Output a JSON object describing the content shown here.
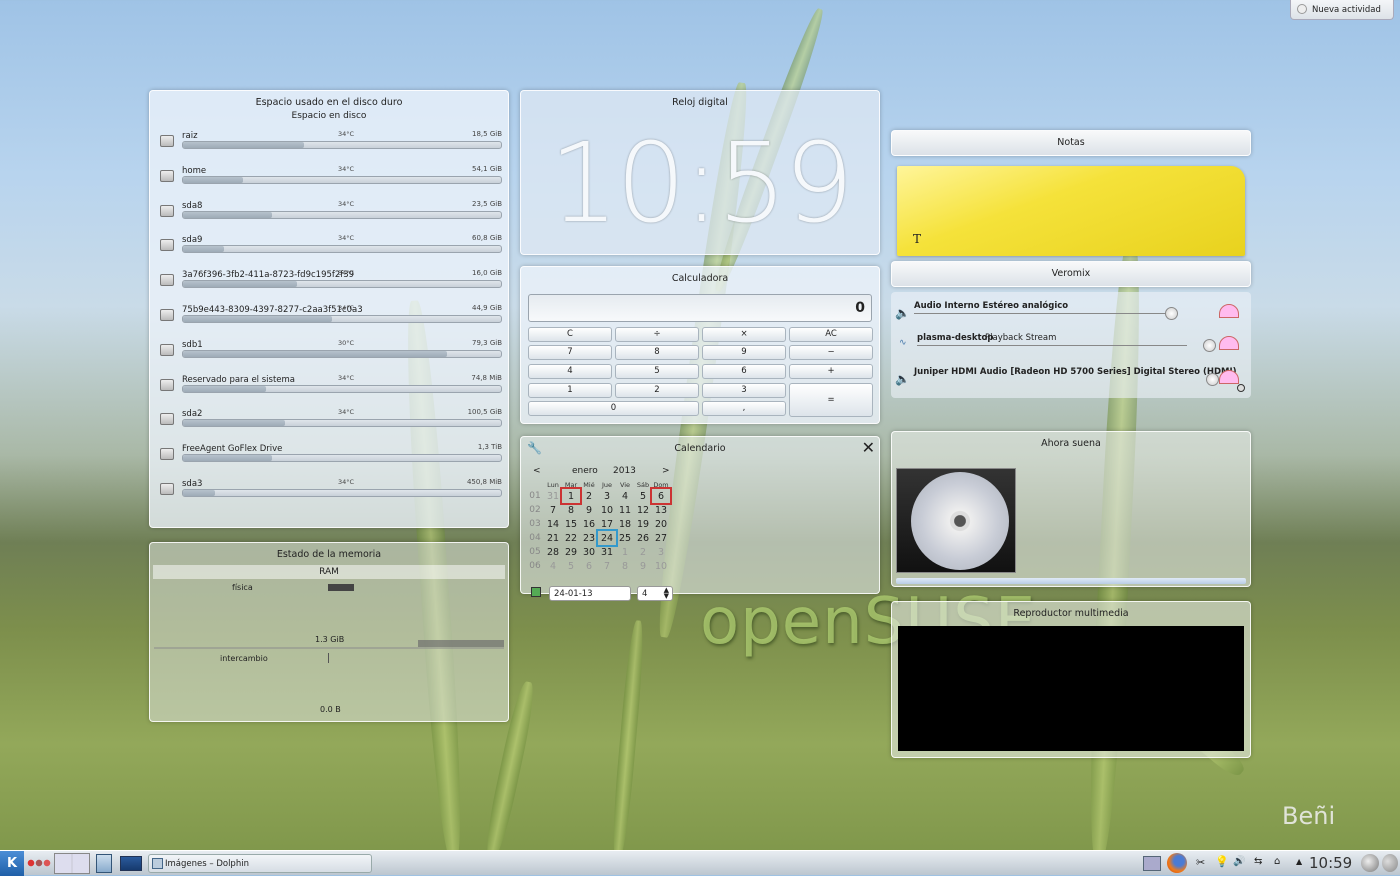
{
  "top_button": {
    "label": "Nueva actividad"
  },
  "disk": {
    "title": "Espacio usado en el disco duro",
    "subtitle": "Espacio en disco",
    "items": [
      {
        "name": "raiz",
        "temp": "34°C",
        "size": "18,5 GiB",
        "used": 0.38
      },
      {
        "name": "home",
        "temp": "34°C",
        "size": "54,1 GiB",
        "used": 0.19
      },
      {
        "name": "sda8",
        "temp": "34°C",
        "size": "23,5 GiB",
        "used": 0.28
      },
      {
        "name": "sda9",
        "temp": "34°C",
        "size": "60,8 GiB",
        "used": 0.13
      },
      {
        "name": "3a76f396-3fb2-411a-8723-fd9c195f2f39",
        "temp": "34°C",
        "size": "16,0 GiB",
        "used": 0.36
      },
      {
        "name": "75b9e443-8309-4397-8277-c2aa3f51c0a3",
        "temp": "34°C",
        "size": "44,9 GiB",
        "used": 0.47
      },
      {
        "name": "sdb1",
        "temp": "30°C",
        "size": "79,3 GiB",
        "used": 0.83
      },
      {
        "name": "Reservado para el sistema",
        "temp": "34°C",
        "size": "74,8 MiB",
        "used": 0.26
      },
      {
        "name": "sda2",
        "temp": "34°C",
        "size": "100,5 GiB",
        "used": 0.32
      },
      {
        "name": "FreeAgent GoFlex Drive",
        "temp": "",
        "size": "1,3 TiB",
        "used": 0.28
      },
      {
        "name": "sda3",
        "temp": "34°C",
        "size": "450,8 MiB",
        "used": 0.1
      }
    ]
  },
  "memory": {
    "title": "Estado de la memoria",
    "subtitle": "RAM",
    "physical_label": "física",
    "physical_value": "1.3 GiB",
    "swap_label": "intercambio",
    "swap_value": "0.0 B"
  },
  "clock": {
    "title": "Reloj digital",
    "time": "10:59"
  },
  "calc": {
    "title": "Calculadora",
    "display": "0",
    "rows": [
      [
        "C",
        "÷",
        "×",
        "AC"
      ],
      [
        "7",
        "8",
        "9",
        "−"
      ],
      [
        "4",
        "5",
        "6",
        "+"
      ],
      [
        "1",
        "2",
        "3",
        "="
      ],
      [
        "0",
        ","
      ]
    ]
  },
  "calendar": {
    "title": "Calendario",
    "prev": "<",
    "next": ">",
    "month": "enero",
    "year": "2013",
    "days": [
      "Lun",
      "Mar",
      "Mié",
      "Jue",
      "Vie",
      "Sáb",
      "Dom"
    ],
    "weeks": [
      {
        "wk": "01",
        "d": [
          "31",
          "1",
          "2",
          "3",
          "4",
          "5",
          "6"
        ]
      },
      {
        "wk": "02",
        "d": [
          "7",
          "8",
          "9",
          "10",
          "11",
          "12",
          "13"
        ]
      },
      {
        "wk": "03",
        "d": [
          "14",
          "15",
          "16",
          "17",
          "18",
          "19",
          "20"
        ]
      },
      {
        "wk": "04",
        "d": [
          "21",
          "22",
          "23",
          "24",
          "25",
          "26",
          "27"
        ]
      },
      {
        "wk": "05",
        "d": [
          "28",
          "29",
          "30",
          "31",
          "1",
          "2",
          "3"
        ]
      },
      {
        "wk": "06",
        "d": [
          "4",
          "5",
          "6",
          "7",
          "8",
          "9",
          "10"
        ]
      }
    ],
    "date_field": "24-01-13",
    "week_field": "4"
  },
  "notes": {
    "title": "Notas",
    "cursor": "T"
  },
  "veromix": {
    "title": "Veromix",
    "channels": [
      {
        "name": "Audio Interno Estéreo analógico",
        "app": ""
      },
      {
        "name": "plasma-desktop",
        "app": "Playback Stream"
      },
      {
        "name": "Juniper HDMI Audio [Radeon HD 5700 Series] Digital Stereo (HDMI)",
        "app": ""
      }
    ]
  },
  "nowplaying": {
    "title": "Ahora suena"
  },
  "media": {
    "title": "Reproductor multimedia"
  },
  "wallpaper": {
    "brand": "openSUSE",
    "signature": "Beñi"
  },
  "taskbar": {
    "task": "Imágenes – Dolphin",
    "time": "10:59"
  }
}
